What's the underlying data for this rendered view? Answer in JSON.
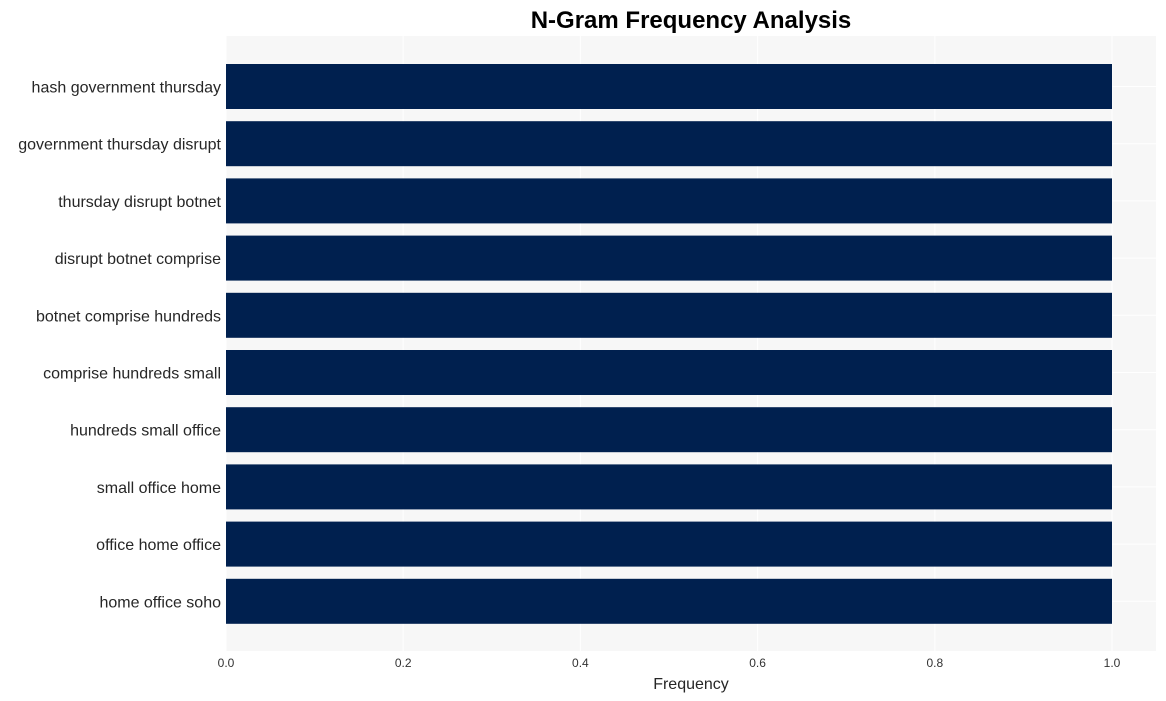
{
  "chart_data": {
    "type": "bar",
    "orientation": "horizontal",
    "title": "N-Gram Frequency Analysis",
    "xlabel": "Frequency",
    "ylabel": "",
    "categories": [
      "hash government thursday",
      "government thursday disrupt",
      "thursday disrupt botnet",
      "disrupt botnet comprise",
      "botnet comprise hundreds",
      "comprise hundreds small",
      "hundreds small office",
      "small office home",
      "office home office",
      "home office soho"
    ],
    "values": [
      1,
      1,
      1,
      1,
      1,
      1,
      1,
      1,
      1,
      1
    ],
    "xlim": [
      0,
      1.05
    ],
    "xticks": [
      0.0,
      0.2,
      0.4,
      0.6,
      0.8,
      1.0
    ],
    "xtick_labels": [
      "0.0",
      "0.2",
      "0.4",
      "0.6",
      "0.8",
      "1.0"
    ],
    "grid": true,
    "legend": "none",
    "colors": {
      "bar": "#00204f",
      "plot_background": "#f7f7f7",
      "grid": "#ffffff",
      "page_background": "#ffffff"
    }
  }
}
